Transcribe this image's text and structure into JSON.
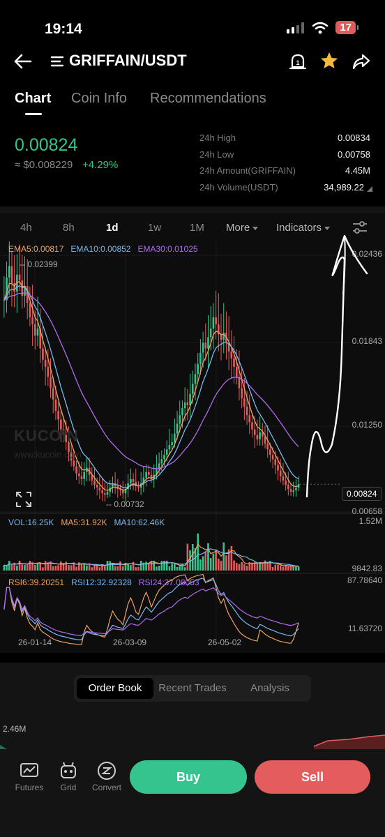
{
  "status_bar": {
    "time": "19:14",
    "battery": "17"
  },
  "header": {
    "title": "GRIFFAIN/USDT"
  },
  "tabs": [
    "Chart",
    "Coin Info",
    "Recommendations"
  ],
  "price": {
    "last": "0.00824",
    "fiat": "≈ $0.008229",
    "change": "+4.29%"
  },
  "stats": [
    {
      "label": "24h High",
      "value": "0.00834"
    },
    {
      "label": "24h Low",
      "value": "0.00758"
    },
    {
      "label": "24h Amount(GRIFFAIN)",
      "value": "4.45M"
    },
    {
      "label": "24h Volume(USDT)",
      "value": "34,989.22"
    }
  ],
  "periods": [
    "4h",
    "8h",
    "1d",
    "1w",
    "1M"
  ],
  "period_active": "1d",
  "period_more": "More",
  "period_indicators": "Indicators",
  "ema_legend": {
    "ema5": "EMA5:0.00817",
    "ema10": "EMA10:0.00852",
    "ema30": "EMA30:0.01025"
  },
  "price_axis": [
    "0.02436",
    "0.01843",
    "0.01250",
    "0.00658"
  ],
  "price_marks": {
    "high_label": "0.02399",
    "low_label": "0.00732",
    "last_label": "0.00824"
  },
  "watermark": {
    "brand": "KUCOIN",
    "url": "www.kucoin.com"
  },
  "vol_legend": {
    "vol": "VOL:16.25K",
    "ma5": "MA5:31.92K",
    "ma10": "MA10:62.46K"
  },
  "vol_axis": {
    "top": "1.52M",
    "bottom": "9842.83"
  },
  "rsi_legend": {
    "rsi6": "RSI6:39.20251",
    "rsi12": "RSI12:32.92328",
    "rsi24": "RSI24:37.08053"
  },
  "rsi_axis": {
    "top": "87.78640",
    "bottom": "11.63720"
  },
  "dates": [
    "26-01-14",
    "26-03-09",
    "26-05-02"
  ],
  "panel_tabs": [
    "Order Book",
    "Recent Trades",
    "Analysis"
  ],
  "depth_label": "2.46M",
  "actions": {
    "futures": "Futures",
    "grid": "Grid",
    "convert": "Convert"
  },
  "buttons": {
    "buy": "Buy",
    "sell": "Sell"
  },
  "colors": {
    "up": "#35c48d",
    "down": "#e35d5d",
    "ema5": "#f0a35e",
    "ema10": "#7ab8f0",
    "ema30": "#b06cf0"
  },
  "chart_data": {
    "type": "candlestick",
    "ylim": [
      0.00658,
      0.02436
    ],
    "x_ticks": [
      "26-01-14",
      "26-03-09",
      "26-05-02"
    ],
    "marked_high": 0.02399,
    "marked_low": 0.00732,
    "last": 0.00824,
    "close_series": [
      0.0212,
      0.0228,
      0.0236,
      0.0224,
      0.0218,
      0.023,
      0.0226,
      0.0215,
      0.0222,
      0.021,
      0.02,
      0.0195,
      0.0187,
      0.0192,
      0.0178,
      0.017,
      0.0165,
      0.0158,
      0.015,
      0.0142,
      0.0134,
      0.0128,
      0.0121,
      0.0117,
      0.0112,
      0.0105,
      0.0099,
      0.0095,
      0.009,
      0.0088,
      0.0086,
      0.0091,
      0.0094,
      0.0089,
      0.0085,
      0.0082,
      0.008,
      0.0078,
      0.0076,
      0.0075,
      0.0077,
      0.008,
      0.0083,
      0.0081,
      0.0079,
      0.0078,
      0.0076,
      0.0079,
      0.0083,
      0.0086,
      0.0084,
      0.0081,
      0.008,
      0.0083,
      0.0087,
      0.0091,
      0.0089,
      0.0086,
      0.0089,
      0.0093,
      0.0097,
      0.01,
      0.0103,
      0.0107,
      0.011,
      0.0112,
      0.0118,
      0.0125,
      0.0131,
      0.0136,
      0.014,
      0.0138,
      0.0146,
      0.0153,
      0.016,
      0.0167,
      0.0175,
      0.0182,
      0.0178,
      0.0186,
      0.0192,
      0.02,
      0.0195,
      0.0188,
      0.0184,
      0.0189,
      0.0182,
      0.0176,
      0.0171,
      0.0165,
      0.0158,
      0.015,
      0.0143,
      0.0137,
      0.0131,
      0.0126,
      0.0121,
      0.0117,
      0.0114,
      0.0119,
      0.0116,
      0.0111,
      0.0107,
      0.0103,
      0.01,
      0.0096,
      0.0092,
      0.0088,
      0.0085,
      0.0082,
      0.0079,
      0.0077,
      0.0078,
      0.008,
      0.00824
    ]
  }
}
